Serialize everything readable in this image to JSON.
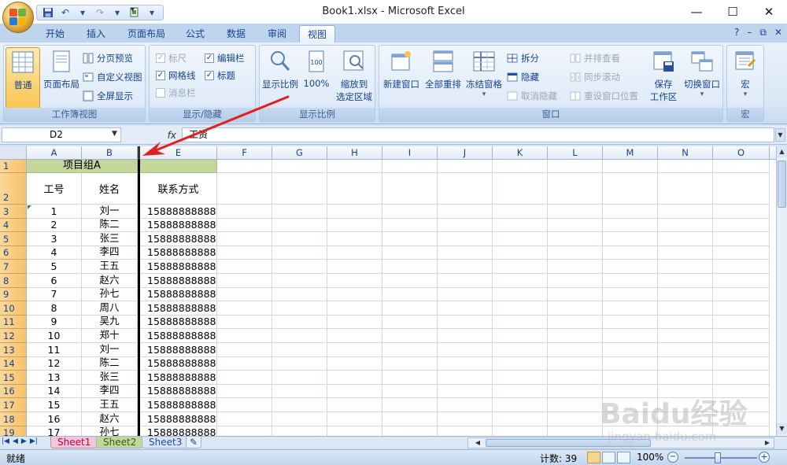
{
  "window": {
    "title": "Book1.xlsx - Microsoft Excel",
    "minimize": "—",
    "maximize": "☐",
    "close": "✕"
  },
  "ribbon_tabs": [
    "开始",
    "插入",
    "页面布局",
    "公式",
    "数据",
    "审阅",
    "视图"
  ],
  "active_tab": "视图",
  "ribbon": {
    "workbook_views": {
      "label": "工作簿视图",
      "normal": "普通",
      "page_layout": "页面布局",
      "page_break_preview": "分页预览",
      "custom_views": "自定义视图",
      "full_screen": "全屏显示"
    },
    "show_hide": {
      "label": "显示/隐藏",
      "ruler": "标尺",
      "formula_bar": "编辑栏",
      "gridlines": "网格线",
      "headings": "标题",
      "message_bar": "消息栏"
    },
    "zoom": {
      "label": "显示比例",
      "zoom": "显示比例",
      "zoom100": "100%",
      "zoom_selection_1": "缩放到",
      "zoom_selection_2": "选定区域"
    },
    "window": {
      "label": "窗口",
      "new_window": "新建窗口",
      "arrange_all": "全部重排",
      "freeze_panes": "冻结窗格",
      "split": "拆分",
      "hide": "隐藏",
      "unhide": "取消隐藏",
      "view_side_by_side": "并排查看",
      "sync_scroll": "同步滚动",
      "reset_position": "重设窗口位置",
      "save_workspace_1": "保存",
      "save_workspace_2": "工作区",
      "switch_windows": "切换窗口"
    },
    "macros": {
      "label": "宏",
      "macros": "宏"
    }
  },
  "formula_bar": {
    "name_box": "D2",
    "fx": "fx",
    "content": "工资"
  },
  "columns": [
    "A",
    "B",
    "E",
    "F",
    "G",
    "H",
    "I",
    "J",
    "K",
    "L",
    "M",
    "N",
    "O"
  ],
  "rows": {
    "r1": {
      "num": "1",
      "a": "项目组A",
      "e": ""
    },
    "r2": {
      "num": "2",
      "a": "工号",
      "b": "姓名",
      "e": "联系方式"
    },
    "data": [
      {
        "num": "3",
        "id": "1",
        "name": "刘一",
        "phone": "15888888888"
      },
      {
        "num": "4",
        "id": "2",
        "name": "陈二",
        "phone": "15888888888"
      },
      {
        "num": "5",
        "id": "3",
        "name": "张三",
        "phone": "15888888888"
      },
      {
        "num": "6",
        "id": "4",
        "name": "李四",
        "phone": "15888888888"
      },
      {
        "num": "7",
        "id": "5",
        "name": "王五",
        "phone": "15888888888"
      },
      {
        "num": "8",
        "id": "6",
        "name": "赵六",
        "phone": "15888888888"
      },
      {
        "num": "9",
        "id": "7",
        "name": "孙七",
        "phone": "15888888888"
      },
      {
        "num": "10",
        "id": "8",
        "name": "周八",
        "phone": "15888888888"
      },
      {
        "num": "11",
        "id": "9",
        "name": "吴九",
        "phone": "15888888888"
      },
      {
        "num": "12",
        "id": "10",
        "name": "郑十",
        "phone": "15888888888"
      },
      {
        "num": "13",
        "id": "11",
        "name": "刘一",
        "phone": "15888888888"
      },
      {
        "num": "14",
        "id": "12",
        "name": "陈二",
        "phone": "15888888888"
      },
      {
        "num": "15",
        "id": "13",
        "name": "张三",
        "phone": "15888888888"
      },
      {
        "num": "16",
        "id": "14",
        "name": "李四",
        "phone": "15888888888"
      },
      {
        "num": "17",
        "id": "15",
        "name": "王五",
        "phone": "15888888888"
      },
      {
        "num": "18",
        "id": "16",
        "name": "赵六",
        "phone": "15888888888"
      },
      {
        "num": "19",
        "id": "17",
        "name": "孙七",
        "phone": "15888888888"
      }
    ]
  },
  "sheets": [
    "Sheet1",
    "Sheet2",
    "Sheet3"
  ],
  "status": {
    "ready": "就绪",
    "count": "计数: 39",
    "zoom": "100%"
  },
  "watermark": {
    "brand": "Baidu经验",
    "url": "jingyan.baidu.com"
  },
  "colors": {
    "header_green": "#c4d79b",
    "arrow_red": "#e02020",
    "selected_rowhdr": "#f6c26a"
  }
}
